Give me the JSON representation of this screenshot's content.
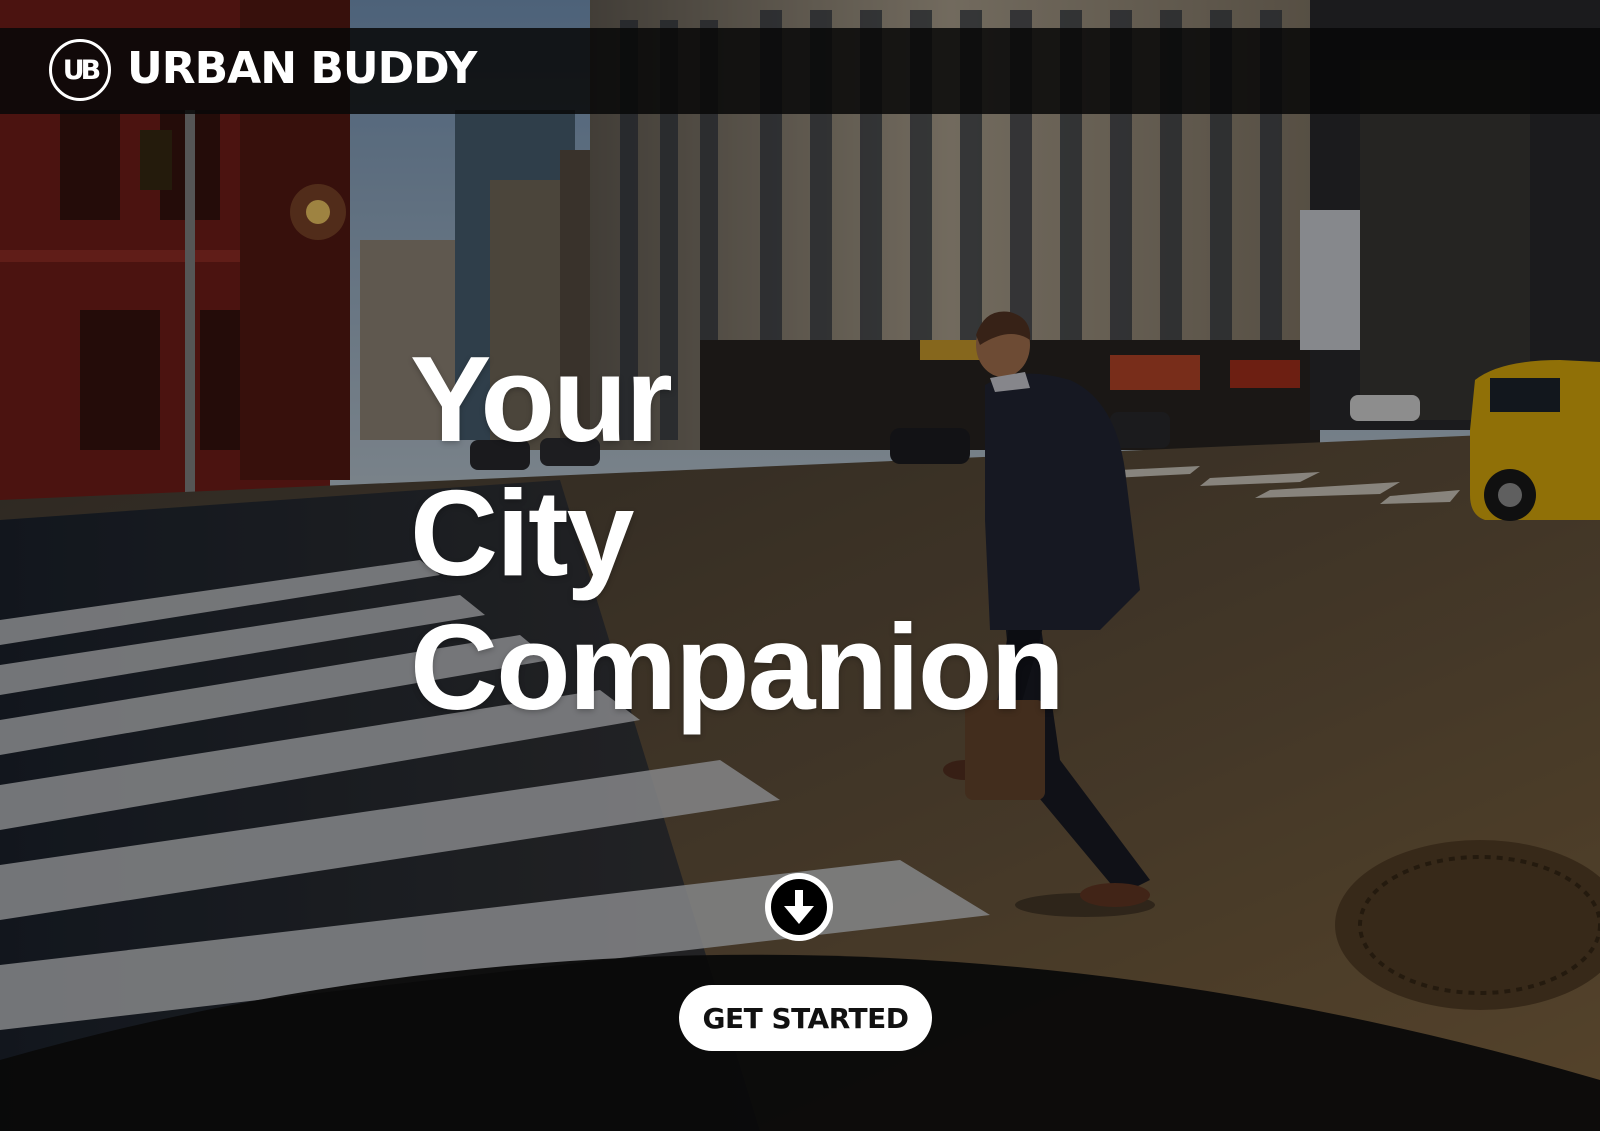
{
  "header": {
    "logo_mark": "UB",
    "brand_name": "URBAN BUDDY"
  },
  "hero": {
    "lines": [
      "Your",
      "City",
      "Companion"
    ]
  },
  "actions": {
    "scroll_icon": "arrow-down-circle-icon",
    "cta_label": "GET STARTED"
  },
  "colors": {
    "header_bg": "#080808",
    "text": "#ffffff",
    "cta_bg": "#ffffff",
    "cta_text": "#111111",
    "bottom_panel": "#0a0a0a",
    "taxi_yellow": "#e8b50c"
  }
}
